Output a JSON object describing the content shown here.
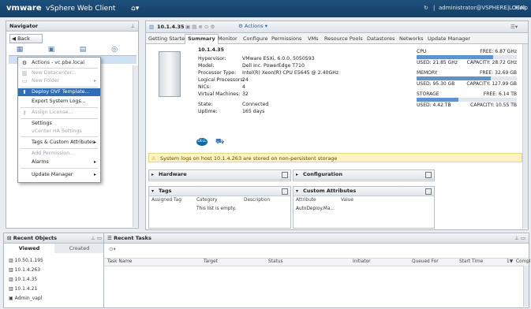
{
  "topbar": {
    "brand": "vmware",
    "product": "vSphere Web Client",
    "user": "administrator@VSPHERE.LOCAL",
    "help": "Help"
  },
  "navigator": {
    "title": "Navigator",
    "back_label": "Back"
  },
  "context_menu": {
    "header": "Actions - vc.pbe.local",
    "items": [
      {
        "label": "New Datacenter...",
        "disabled": true,
        "submenu": false
      },
      {
        "label": "New Folder",
        "disabled": true,
        "submenu": true
      },
      {
        "label": "Deploy OVF Template...",
        "disabled": false,
        "submenu": false,
        "highlighted": true
      },
      {
        "label": "Export System Logs...",
        "disabled": false,
        "submenu": false
      },
      {
        "label": "Assign License...",
        "disabled": true,
        "submenu": false
      },
      {
        "label": "Settings",
        "disabled": false,
        "submenu": false
      },
      {
        "label": "vCenter HA Settings",
        "disabled": true,
        "submenu": false
      },
      {
        "label": "Tags & Custom Attributes",
        "disabled": false,
        "submenu": true
      },
      {
        "label": "Add Permission...",
        "disabled": true,
        "submenu": false
      },
      {
        "label": "Alarms",
        "disabled": false,
        "submenu": true
      },
      {
        "label": "Update Manager",
        "disabled": false,
        "submenu": true
      }
    ]
  },
  "object": {
    "name": "10.1.4.35",
    "actions_label": "Actions"
  },
  "tabs": [
    "Getting Started",
    "Summary",
    "Monitor",
    "Configure",
    "Permissions",
    "VMs",
    "Resource Pools",
    "Datastores",
    "Networks",
    "Update Manager"
  ],
  "summary": {
    "host": "10.1.4.35",
    "fields": [
      {
        "k": "Hypervisor:",
        "v": "VMware ESXi, 6.0.0, 5050593"
      },
      {
        "k": "Model:",
        "v": "Dell Inc. PowerEdge T710"
      },
      {
        "k": "Processor Type:",
        "v": "Intel(R) Xeon(R) CPU E5645 @ 2.40GHz"
      },
      {
        "k": "Logical Processors:",
        "v": "24"
      },
      {
        "k": "NICs:",
        "v": "4"
      },
      {
        "k": "Virtual Machines:",
        "v": "32"
      },
      {
        "k": "State:",
        "v": "Connected"
      },
      {
        "k": "Uptime:",
        "v": "165 days"
      }
    ],
    "cpu": {
      "label": "CPU",
      "free": "FREE: 6.87 GHz",
      "used": "USED: 21.85 GHz",
      "capacity": "CAPACITY: 28.72 GHz",
      "fraction": 0.76
    },
    "memory": {
      "label": "MEMORY",
      "free": "FREE: 32.69 GB",
      "used": "USED: 95.30 GB",
      "capacity": "CAPACITY: 127.99 GB",
      "fraction": 0.74
    },
    "storage": {
      "label": "STORAGE",
      "free": "FREE: 6.14 TB",
      "used": "USED: 4.42 TB",
      "capacity": "CAPACITY: 10.55 TB",
      "fraction": 0.42
    }
  },
  "alert": "System logs on host 10.1.4.263 are stored on non-persistent storage",
  "portlets": {
    "hardware": "Hardware",
    "configuration": "Configuration",
    "tags": "Tags",
    "tags_cols": [
      "Assigned Tag",
      "Category",
      "Description"
    ],
    "tags_empty": "This list is empty.",
    "custom_attributes": "Custom Attributes",
    "ca_cols": [
      "Attribute",
      "Value"
    ],
    "ca_row": "AutoDeploy.Ma..."
  },
  "recent_objects": {
    "title": "Recent Objects",
    "tab_viewed": "Viewed",
    "tab_created": "Created",
    "items": [
      "10.50.1.195",
      "10.1.4.263",
      "10.1.4.35",
      "10.1.4.21",
      "Admin_vapl"
    ]
  },
  "recent_tasks": {
    "title": "Recent Tasks",
    "columns": [
      "Task Name",
      "Target",
      "Status",
      "Initiator",
      "Queued For",
      "Start Time",
      "Compl"
    ]
  }
}
